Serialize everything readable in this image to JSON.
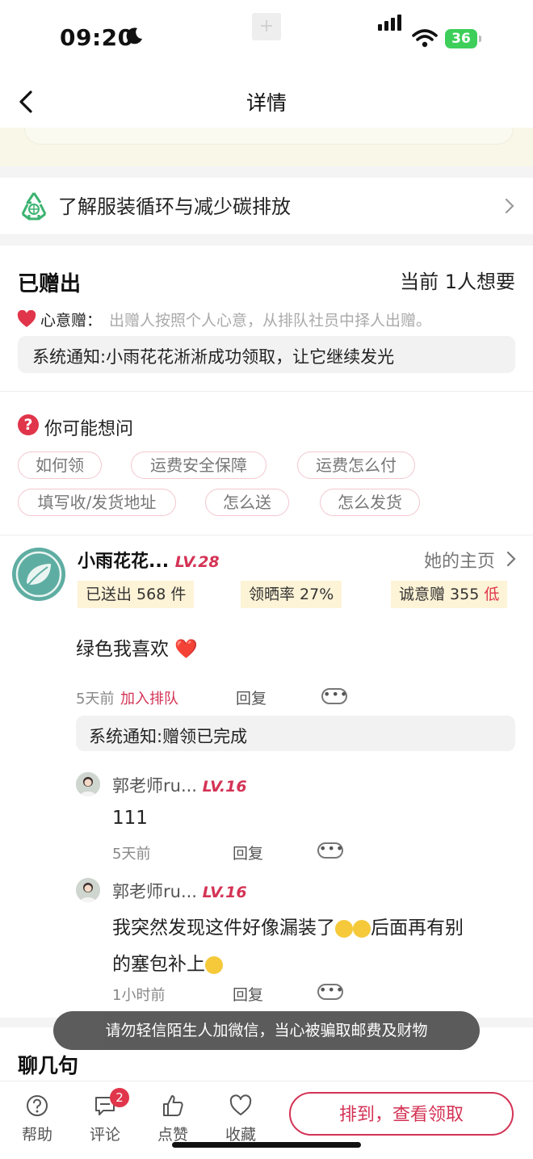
{
  "status_bar": {
    "time": "09:20",
    "battery": "36"
  },
  "nav": {
    "title": "详情"
  },
  "recycle": {
    "text": "了解服装循环与减少碳排放"
  },
  "given": {
    "title": "已赠出",
    "status": "当前 1人想要",
    "heart_label": "心意赠：",
    "heart_desc": "出赠人按照个人心意，从排队社员中择人出赠。",
    "notice": "系统通知:小雨花花淅淅成功领取，让它继续发光"
  },
  "faq": {
    "title": "你可能想问",
    "chips": [
      "如何领",
      "运费安全保障",
      "运费怎么付",
      "填写收/发货地址",
      "怎么送",
      "怎么发货"
    ]
  },
  "post": {
    "username": "小雨花花...",
    "level": "LV.28",
    "homepage": "她的主页",
    "stats": {
      "sent": "已送出 568 件",
      "rate": "领晒率 27%",
      "sincerity": "诚意赠 355",
      "sincerity_level": "低"
    },
    "comment": "绿色我喜欢 ❤️",
    "time": "5天前",
    "join": "加入排队",
    "reply": "回复",
    "system": "系统通知:赠领已完成"
  },
  "replies": [
    {
      "username": "郭老师ru...",
      "level": "LV.16",
      "line1": "111",
      "time": "5天前",
      "reply": "回复"
    },
    {
      "username": "郭老师ru...",
      "level": "LV.16",
      "line1_a": "我突然发现这件好像漏装了",
      "line1_b": "后面再有别",
      "line2": "的塞包补上",
      "time": "1小时前",
      "reply": "回复"
    }
  ],
  "toast": "请勿轻信陌生人加微信，当心被骗取邮费及财物",
  "chat": {
    "title": "聊几句"
  },
  "tabbar": {
    "help": "帮助",
    "comment": "评论",
    "comment_badge": "2",
    "like": "点赞",
    "collect": "收藏",
    "cta": "排到，查看领取"
  }
}
